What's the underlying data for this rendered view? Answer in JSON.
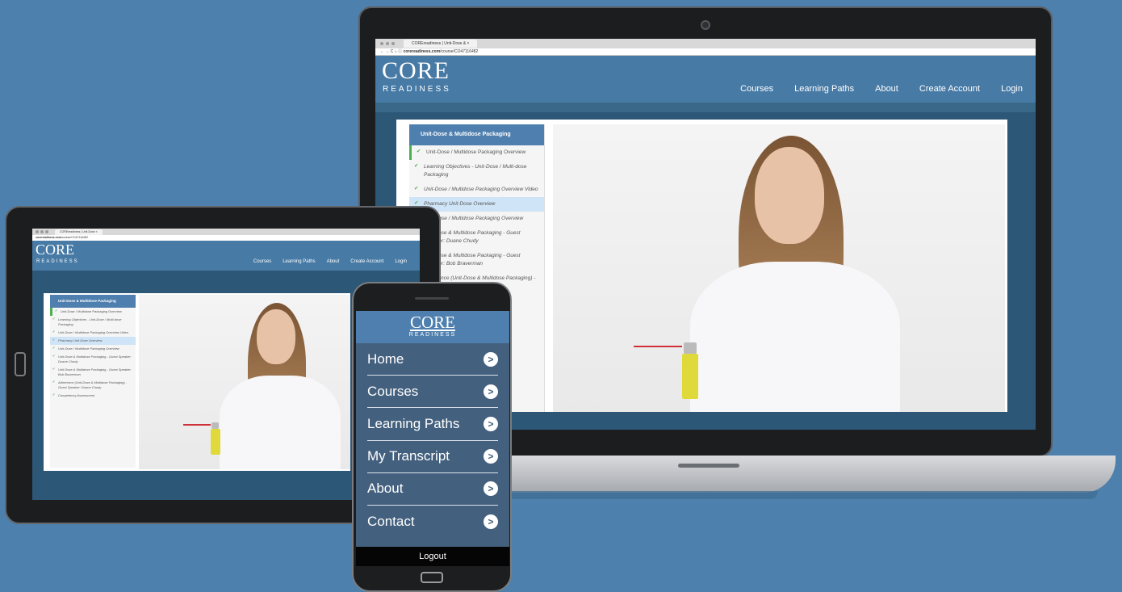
{
  "laptop": {
    "tab_title": "COREreadiness | Unit-Dose & ×",
    "url_domain": "corereadiness.com",
    "url_path": "/course/CO47116482",
    "logo_main": "CORE",
    "logo_sub": "READINESS",
    "nav": [
      "Courses",
      "Learning Paths",
      "About",
      "Create Account",
      "Login"
    ],
    "sidebar_title": "Unit-Dose & Multidose Packaging",
    "sidebar_items": [
      "Unit-Dose / Multidose Packaging Overview",
      "Learning Objectives - Unit-Dose / Multi-dose Packaging",
      "Unit-Dose / Multidose Packaging Overview Video",
      "Pharmacy Unit Dose Overview",
      "Unit-Dose / Multidose Packaging Overview",
      "Unit Dose & Multidose Packaging - Guest Speaker: Duane Chudy",
      "Unit Dose & Multidose Packaging - Guest Speaker: Bob Braverman",
      "Adherence (Unit-Dose & Multidose Packaging) - Guest Speaker: Duane Chudy"
    ]
  },
  "tablet": {
    "tab_title": "COREreadiness | Unit-Dose ×",
    "url_domain": "corereadiness.com",
    "url_path": "/course/CO47116482",
    "logo_main": "CORE",
    "logo_sub": "READINESS",
    "nav": [
      "Courses",
      "Learning Paths",
      "About",
      "Create Account",
      "Login"
    ],
    "sidebar_title": "Unit-Dose & Multidose Packaging",
    "sidebar_items": [
      "Unit-Dose / Multidose Packaging Overview",
      "Learning Objectives - Unit-Dose / Multi-dose Packaging",
      "Unit-Dose / Multidose Packaging Overview Video",
      "Pharmacy Unit Dose Overview",
      "Unit-Dose / Multidose Packaging Overview",
      "Unit Dose & Multidose Packaging - Guest Speaker: Duane Chudy",
      "Unit Dose & Multidose Packaging - Guest Speaker: Bob Braverman",
      "Adherence (Unit-Dose & Multidose Packaging) - Guest Speaker: Duane Chudy",
      "Competency Assessment"
    ]
  },
  "phone": {
    "logo_main": "CORE",
    "logo_sub": "READINESS",
    "menu": [
      {
        "label": "Home"
      },
      {
        "label": "Courses"
      },
      {
        "label": "Learning Paths"
      },
      {
        "label": "My Transcript"
      },
      {
        "label": "About"
      },
      {
        "label": "Contact"
      }
    ],
    "logout": "Logout"
  },
  "colors": {
    "brand": "#477aa5",
    "background": "#4d80ad",
    "check": "#4caf50"
  }
}
